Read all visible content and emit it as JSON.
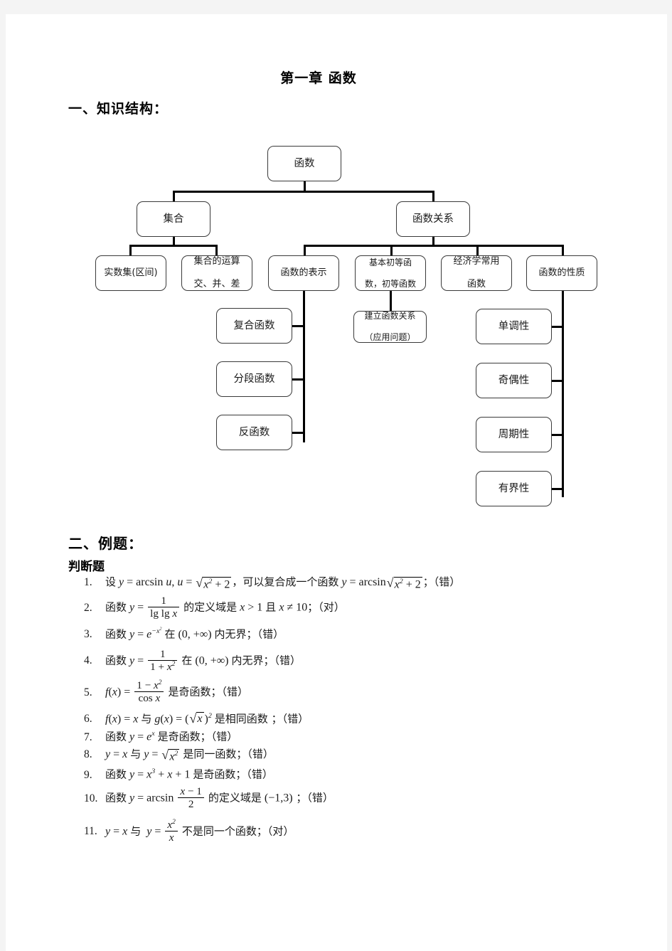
{
  "document": {
    "title": "第一章 函数",
    "section1_heading": "一、知识结构：",
    "section2_heading": "二、例题：",
    "subheading": "判断题"
  },
  "diagram": {
    "root": "函数",
    "level2": [
      "集合",
      "函数关系"
    ],
    "level3": [
      "实数集(区间)",
      "集合的运算\n交、并、差",
      "函数的表示",
      "基本初等函\n数，初等函数",
      "经济学常用\n函数",
      "函数的性质"
    ],
    "nodes": {
      "root": "函数",
      "set": "集合",
      "function_relation": "函数关系",
      "real_number_set": "实数集(区间)",
      "set_operations_line1": "集合的运算",
      "set_operations_line2": "交、并、差",
      "function_representation": "函数的表示",
      "elementary_line1": "基本初等函",
      "elementary_line2": "数，初等函数",
      "economics_line1": "经济学常用",
      "economics_line2": "函数",
      "function_properties": "函数的性质",
      "composite_function": "复合函数",
      "piecewise_function": "分段函数",
      "inverse_function": "反函数",
      "build_relation_line1": "建立函数关系",
      "build_relation_line2": "（应用问题）",
      "monotonicity": "单调性",
      "parity": "奇偶性",
      "periodicity": "周期性",
      "boundedness": "有界性"
    }
  },
  "exercises": [
    {
      "num": "1.",
      "answer": "（错）"
    },
    {
      "num": "2.",
      "answer": "（对）"
    },
    {
      "num": "3.",
      "answer": "（错）"
    },
    {
      "num": "4.",
      "answer": "（错）"
    },
    {
      "num": "5.",
      "answer": "（错）"
    },
    {
      "num": "6.",
      "answer": "（错）"
    },
    {
      "num": "7.",
      "answer": "（错）"
    },
    {
      "num": "8.",
      "answer": "（错）"
    },
    {
      "num": "9.",
      "answer": "（错）"
    },
    {
      "num": "10.",
      "answer": "（错）"
    },
    {
      "num": "11.",
      "answer": "（对）"
    }
  ],
  "exercise_text": {
    "q1": {
      "lead": "设",
      "mid": "，可以复合成一个函数",
      "tail": "；"
    },
    "q2": {
      "lead": "函数",
      "mid": "的定义域是",
      "tail": "；"
    },
    "q3": {
      "lead": "函数",
      "mid": "在",
      "tail": "内无界；"
    },
    "q4": {
      "lead": "函数",
      "mid": "在",
      "tail": "内无界；"
    },
    "q5": {
      "tail": "是奇函数；"
    },
    "q6": {
      "with": "与",
      "tail": "是相同函数  ；"
    },
    "q7": {
      "lead": "函数",
      "tail": "是奇函数；"
    },
    "q8": {
      "with": "与",
      "tail": " 是同一函数；"
    },
    "q9": {
      "lead": "函数",
      "tail": "是奇函数；"
    },
    "q10": {
      "lead": "函数",
      "mid": "的定义域是",
      "tail": "  ；"
    },
    "q11": {
      "with": "与",
      "tail": "不是同一个函数；"
    }
  },
  "colors": {
    "page_background": "#ffffff",
    "canvas_background": "#f4f4f4",
    "text": "#1a1a1a",
    "node_border": "#3a3a3a",
    "connector": "#000000"
  }
}
